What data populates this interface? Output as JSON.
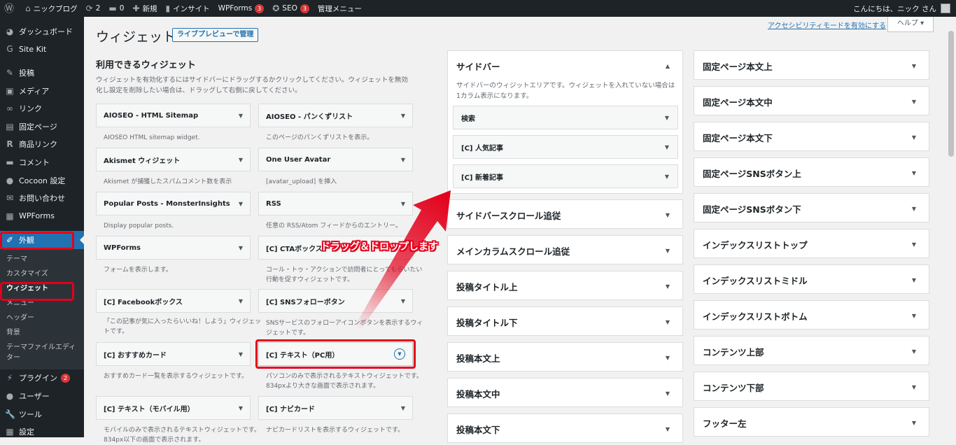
{
  "adminbar": {
    "site_name": "ニックブログ",
    "updates_count": "2",
    "comments_count": "0",
    "new_label": "新規",
    "insight_label": "インサイト",
    "wpforms_label": "WPForms",
    "wpforms_badge": "3",
    "seo_label": "SEO",
    "seo_badge": "3",
    "admin_menu_label": "管理メニュー",
    "greeting": "こんにちは、ニック さん"
  },
  "sidebar": {
    "items": [
      {
        "label": "ダッシュボード",
        "icon": "dashboard-icon"
      },
      {
        "label": "Site Kit",
        "icon": "sitekit-icon"
      },
      {
        "label": "投稿",
        "icon": "pin-icon"
      },
      {
        "label": "メディア",
        "icon": "media-icon"
      },
      {
        "label": "リンク",
        "icon": "link-icon"
      },
      {
        "label": "固定ページ",
        "icon": "page-icon"
      },
      {
        "label": "商品リンク",
        "icon": "rinker-icon"
      },
      {
        "label": "コメント",
        "icon": "comment-icon"
      },
      {
        "label": "Cocoon 設定",
        "icon": "cocoon-icon"
      },
      {
        "label": "お問い合わせ",
        "icon": "mail-icon"
      },
      {
        "label": "WPForms",
        "icon": "wpforms-icon"
      }
    ],
    "appearance": "外観",
    "submenu": [
      "テーマ",
      "カスタマイズ",
      "ウィジェット",
      "メニュー",
      "ヘッダー",
      "背景",
      "テーマファイルエディター"
    ],
    "bottom": [
      {
        "label": "プラグイン",
        "icon": "plugin-icon",
        "badge": "2"
      },
      {
        "label": "ユーザー",
        "icon": "user-icon"
      },
      {
        "label": "ツール",
        "icon": "tool-icon"
      },
      {
        "label": "設定",
        "icon": "settings-icon"
      }
    ]
  },
  "header": {
    "title": "ウィジェット",
    "live_preview": "ライブプレビューで管理",
    "a11y_link": "アクセシビリティモードを有効にする",
    "help": "ヘルプ ▾"
  },
  "available": {
    "title": "利用できるウィジェット",
    "description": "ウィジェットを有効化するにはサイドバーにドラッグするかクリックしてください。ウィジェットを無効化し設定を削除したい場合は、ドラッグして右側に戻してください。",
    "widgets": [
      {
        "name": "AIOSEO - HTML Sitemap",
        "desc": "AIOSEO HTML sitemap widget."
      },
      {
        "name": "AIOSEO - パンくずリスト",
        "desc": "このページのパンくずリストを表示。"
      },
      {
        "name": "Akismet ウィジェット",
        "desc": "Akismet が捕獲したスパムコメント数を表示"
      },
      {
        "name": "One User Avatar",
        "desc": "[avatar_upload] を挿入"
      },
      {
        "name": "Popular Posts - MonsterInsights",
        "desc": "Display popular posts."
      },
      {
        "name": "RSS",
        "desc": "任意の RSS/Atom フィードからのエントリー。"
      },
      {
        "name": "WPForms",
        "desc": "フォームを表示します。"
      },
      {
        "name": "[C] CTAボックス",
        "desc": "コール・トゥ・アクションで訪問者にとってもらいたい行動を促すウィジェットです。"
      },
      {
        "name": "[C] Facebookボックス",
        "desc": "「この記事が気に入ったらいいね！しよう」ウィジェットです。"
      },
      {
        "name": "[C] SNSフォローボタン",
        "desc": "SNSサービスのフォローアイコンボタンを表示するウィジェットです。"
      },
      {
        "name": "[C] おすすめカード",
        "desc": "おすすめカード一覧を表示するウィジェットです。"
      },
      {
        "name": "[C] テキスト（PC用）",
        "desc": "パソコンのみで表示されるテキストウィジェットです。834pxより大きな画面で表示されます。"
      },
      {
        "name": "[C] テキスト（モバイル用）",
        "desc": "モバイルのみで表示されるテキストウィジェットです。834px以下の画面で表示されます。"
      },
      {
        "name": "[C] ナビカード",
        "desc": "ナビカードリストを表示するウィジェットです。"
      }
    ]
  },
  "sidebar_area": {
    "title": "サイドバー",
    "description": "サイドバーのウィジットエリアです。ウィジェットを入れていない場合は1カラム表示になります。",
    "widgets": [
      "検索",
      "[C] 人気記事",
      "[C] 新着記事"
    ]
  },
  "areas_col1": [
    "サイドバースクロール追従",
    "メインカラムスクロール追従",
    "投稿タイトル上",
    "投稿タイトル下",
    "投稿本文上",
    "投稿本文中",
    "投稿本文下"
  ],
  "areas_col2": [
    "固定ページ本文上",
    "固定ページ本文中",
    "固定ページ本文下",
    "固定ページSNSボタン上",
    "固定ページSNSボタン下",
    "インデックスリストトップ",
    "インデックスリストミドル",
    "インデックスリストボトム",
    "コンテンツ上部",
    "コンテンツ下部",
    "フッター左"
  ],
  "annotation": {
    "text": "ドラッグ＆ドロップします",
    "color": "#e3001b"
  }
}
